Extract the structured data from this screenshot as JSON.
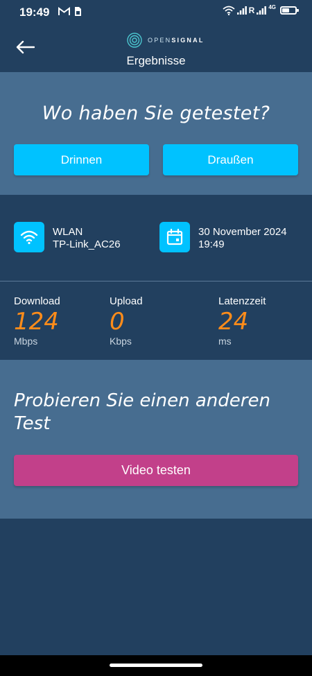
{
  "status_bar": {
    "time": "19:49",
    "network_label": "R",
    "network_type": "4G",
    "icons": [
      "gmail-icon",
      "sim-icon",
      "wifi-icon",
      "signal-icon",
      "signal-icon",
      "battery-icon"
    ]
  },
  "header": {
    "logo_prefix": "OPEN",
    "logo_suffix": "SIGNAL",
    "title": "Ergebnisse",
    "back_icon": "arrow-left-icon"
  },
  "location": {
    "question": "Wo haben Sie getestet?",
    "inside_label": "Drinnen",
    "outside_label": "Draußen"
  },
  "info": {
    "connection_type": "WLAN",
    "network_name": "TP-Link_AC26",
    "date": "30 November 2024",
    "time": "19:49"
  },
  "results": {
    "download": {
      "label": "Download",
      "value": "124",
      "unit": "Mbps"
    },
    "upload": {
      "label": "Upload",
      "value": "0",
      "unit": "Kbps"
    },
    "latency": {
      "label": "Latenzzeit",
      "value": "24",
      "unit": "ms"
    }
  },
  "other_test": {
    "title": "Probieren Sie einen anderen Test",
    "video_button": "Video testen"
  },
  "colors": {
    "background_dark": "#22405f",
    "section_light": "#476d90",
    "accent_blue": "#00c2ff",
    "accent_orange": "#ff8c1a",
    "accent_pink": "#c2408a"
  }
}
